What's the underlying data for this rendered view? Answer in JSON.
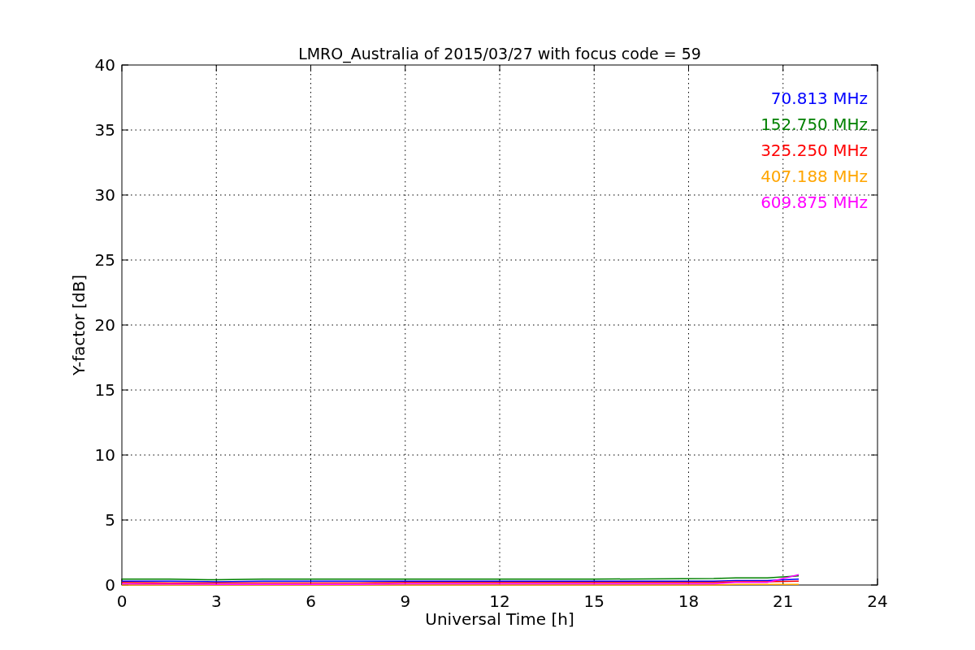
{
  "chart_data": {
    "type": "line",
    "title": "LMRO_Australia of 2015/03/27 with focus code = 59",
    "xlabel": "Universal Time [h]",
    "ylabel": "Y-factor [dB]",
    "x": [
      0,
      1.5,
      3,
      4.5,
      6,
      7.5,
      9,
      12,
      15,
      18.8,
      19.5,
      20.5,
      21.5
    ],
    "series": [
      {
        "name": "70.813 MHz",
        "color": "#0000ff",
        "values": [
          0.3,
          0.3,
          0.25,
          0.3,
          0.3,
          0.3,
          0.3,
          0.3,
          0.3,
          0.3,
          0.35,
          0.35,
          0.45
        ]
      },
      {
        "name": "152.750 MHz",
        "color": "#008000",
        "values": [
          0.45,
          0.45,
          0.4,
          0.45,
          0.45,
          0.45,
          0.45,
          0.45,
          0.45,
          0.5,
          0.55,
          0.55,
          0.7
        ]
      },
      {
        "name": "325.250 MHz",
        "color": "#ff0000",
        "values": [
          0.2,
          0.15,
          0.15,
          0.15,
          0.15,
          0.15,
          0.2,
          0.2,
          0.2,
          0.2,
          0.25,
          0.25,
          0.3
        ]
      },
      {
        "name": "407.188 MHz",
        "color": "#ffa500",
        "values": [
          0,
          0,
          0,
          0,
          0,
          0,
          0,
          0,
          0,
          0,
          0.05,
          0.05,
          0.05
        ]
      },
      {
        "name": "609.875 MHz",
        "color": "#ff00ff",
        "values": [
          0.1,
          0.08,
          0.05,
          0.05,
          0.05,
          0.05,
          0.1,
          0.1,
          0.1,
          0.1,
          0.2,
          0.2,
          0.8
        ]
      }
    ],
    "xlim": [
      0,
      24
    ],
    "ylim": [
      0,
      40
    ],
    "grid": true,
    "xticks": [
      0,
      3,
      6,
      9,
      12,
      15,
      18,
      21,
      24
    ],
    "yticks": [
      0,
      5,
      10,
      15,
      20,
      25,
      30,
      35,
      40
    ]
  }
}
